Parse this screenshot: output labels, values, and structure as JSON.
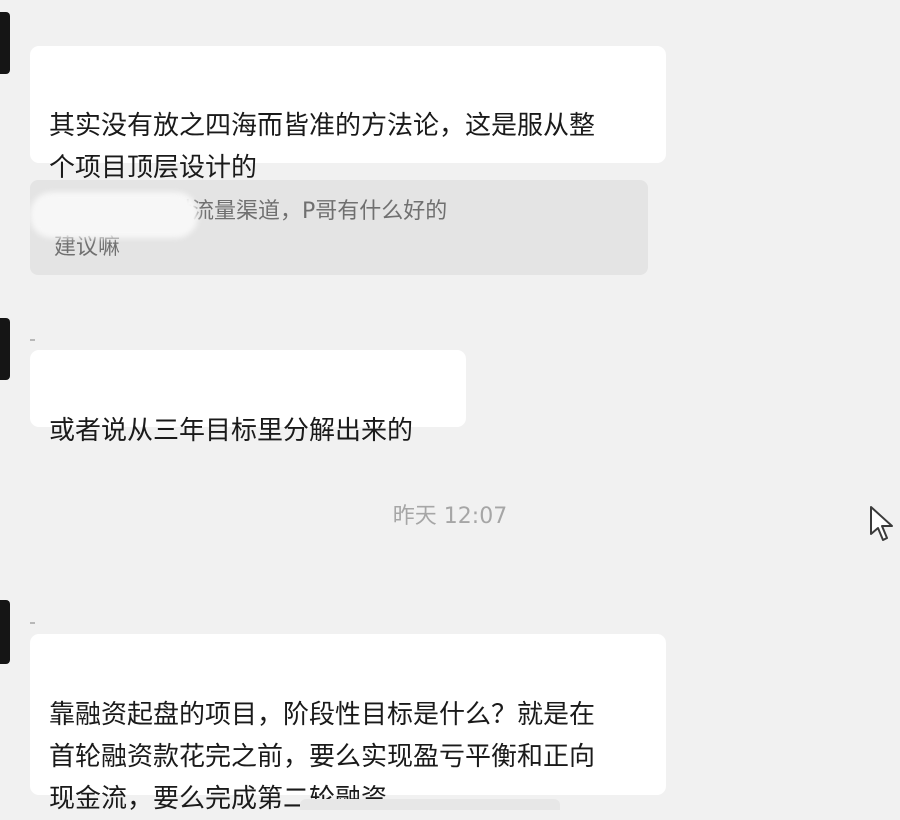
{
  "chat": {
    "messages": [
      {
        "text": "其实没有放之四海而皆准的方法论，这是服从整\n个项目顶层设计的"
      },
      {
        "text": "或者说从三年目标里分解出来的"
      },
      {
        "text": "靠融资起盘的项目，阶段性目标是什么？就是在\n首轮融资款花完之前，要么实现盈亏平衡和正向\n现金流，要么完成第二轮融资"
      }
    ],
    "quote": {
      "visible_text": "：,.. 对于选对流量渠道，P哥有什么好的\n建议嘛"
    },
    "timestamp": "昨天 12:07"
  },
  "colors": {
    "background": "#f1f1f1",
    "bubble": "#ffffff",
    "quote_background": "#e4e4e4",
    "timestamp_text": "#a6a6a6"
  },
  "icons": {
    "cursor": "mouse-pointer-icon"
  }
}
